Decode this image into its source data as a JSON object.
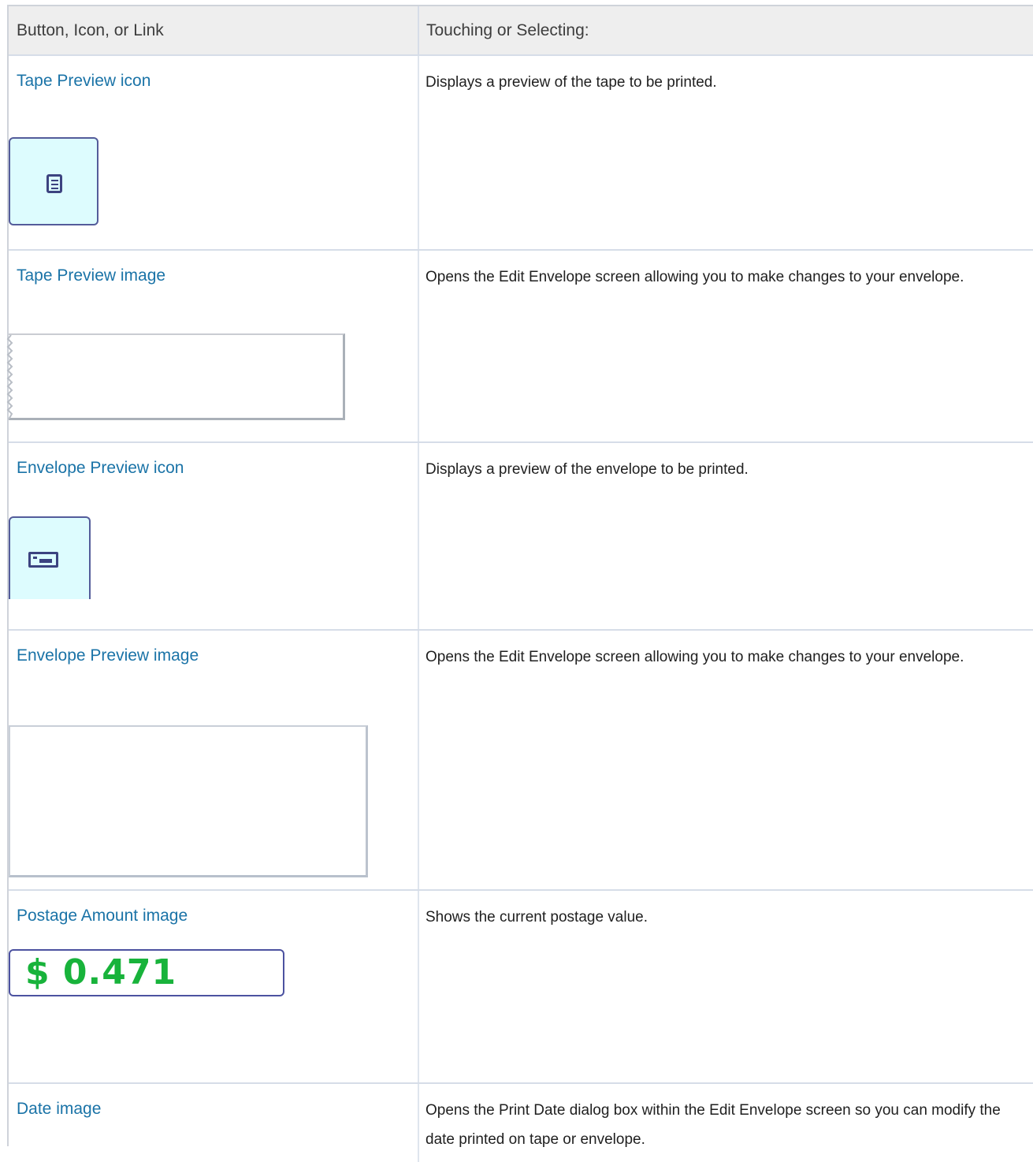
{
  "table": {
    "headers": [
      "Button, Icon, or Link",
      "Touching or Selecting:"
    ],
    "rows": [
      {
        "item": "Tape Preview icon",
        "description": "Displays a preview of the tape to be printed.",
        "image_icon": "tape-preview-icon"
      },
      {
        "item": "Tape Preview image",
        "description": "Opens the Edit Envelope screen allowing you to make changes to your envelope.",
        "image_icon": "tape-preview-image"
      },
      {
        "item": "Envelope Preview icon",
        "description": "Displays a preview of the envelope to be printed.",
        "image_icon": "envelope-preview-icon"
      },
      {
        "item": "Envelope Preview image",
        "description": "Opens the Edit Envelope screen allowing you to make changes to your envelope.",
        "image_icon": "envelope-preview-image"
      },
      {
        "item": "Postage Amount image",
        "description": "Shows the current postage value.",
        "image_icon": "postage-amount-image",
        "postage_value": "$ 0.471"
      },
      {
        "item": "Date image",
        "description": "Opens the Print Date dialog box within the Edit Envelope screen so you can modify the date printed on tape or envelope."
      }
    ]
  },
  "colors": {
    "link": "#1a73a7",
    "icon_fill": "#ddfcfe",
    "icon_border": "#545c9a",
    "postage_green": "#18b33b",
    "header_bg": "#eeeeee"
  }
}
